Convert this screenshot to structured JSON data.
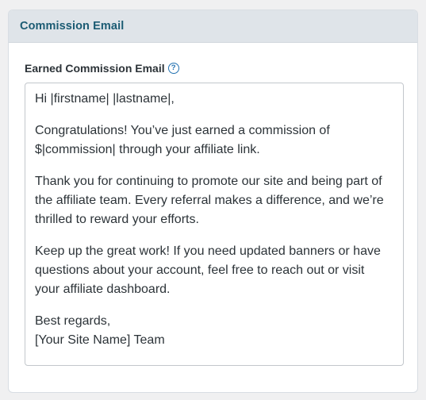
{
  "panel": {
    "title": "Commission Email"
  },
  "field": {
    "label": "Earned Commission Email",
    "help_icon": "question-circle-icon",
    "help_glyph": "?"
  },
  "email_body": {
    "paragraphs": [
      "Hi |firstname| |lastname|,",
      "Congratulations! You’ve just earned a commission of\n$|commission| through your affiliate link.",
      "Thank you for continuing to promote our site and being part of\nthe affiliate team. Every referral makes a difference, and we’re\nthrilled to reward your efforts.",
      "Keep up the great work! If you need updated banners or have\nquestions about your account, feel free to reach out or visit\nyour affiliate dashboard.",
      "Best regards,\n[Your Site Name] Team"
    ]
  },
  "colors": {
    "accent": "#2271b1",
    "title": "#1b5b73",
    "header_bg": "#dfe4e9"
  }
}
